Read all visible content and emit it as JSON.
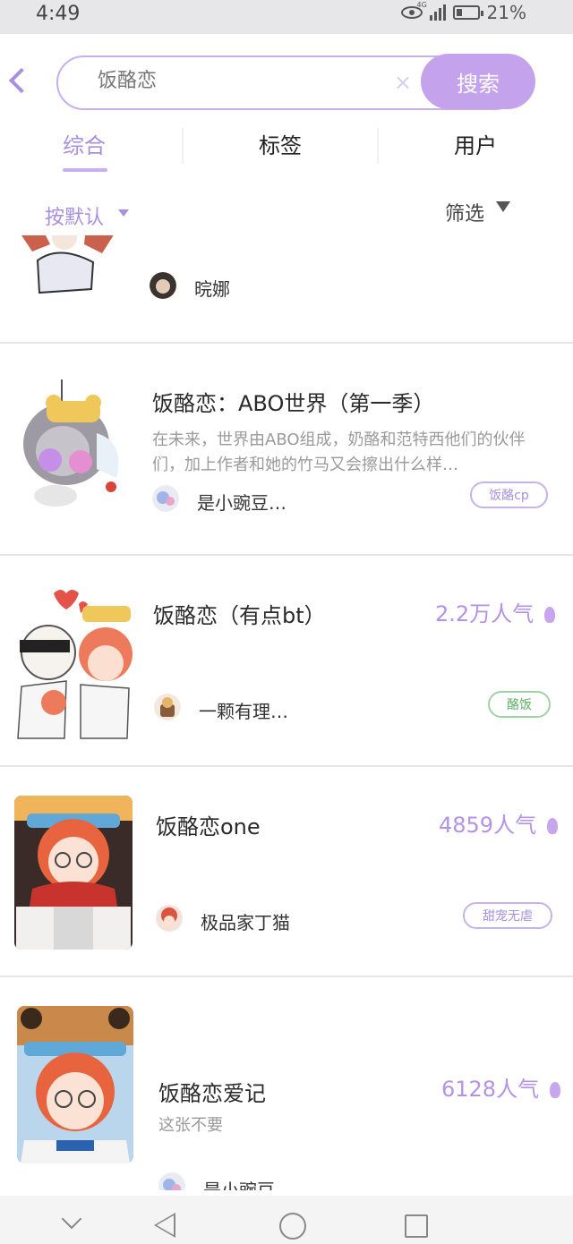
{
  "status_bar": {
    "time": "4:49",
    "network": "4G",
    "battery": "21%"
  },
  "search": {
    "placeholder": "饭酪恋",
    "button_label": "搜索"
  },
  "tabs": [
    {
      "label": "综合",
      "active": true
    },
    {
      "label": "标签",
      "active": false
    },
    {
      "label": "用户",
      "active": false
    }
  ],
  "filter": {
    "sort_label": "按默认",
    "filter_label": "筛选"
  },
  "results": [
    {
      "author": "晥娜"
    },
    {
      "title": "饭酪恋：ABO世界（第一季）",
      "description": "在未来，世界由ABO组成，奶酪和范特西他们的伙伴们，加上作者和她的竹马又会擦出什么样…",
      "author": "是小豌豆…",
      "tag": "饭酪cp"
    },
    {
      "title": "饭酪恋（有点bt）",
      "popularity": "2.2万人气",
      "author": "一颗有理…",
      "tag": "酪饭"
    },
    {
      "title": "饭酪恋one",
      "popularity": "4859人气",
      "author": "极品家丁猫",
      "tag": "甜宠无虐"
    },
    {
      "title": "饭酪恋爱记",
      "description": "这张不要",
      "popularity": "6128人气",
      "author": "是小豌豆…"
    }
  ],
  "colors": {
    "accent": "#c4a3ec",
    "accent_text": "#a98fde",
    "tag_green": "#5fae66"
  }
}
